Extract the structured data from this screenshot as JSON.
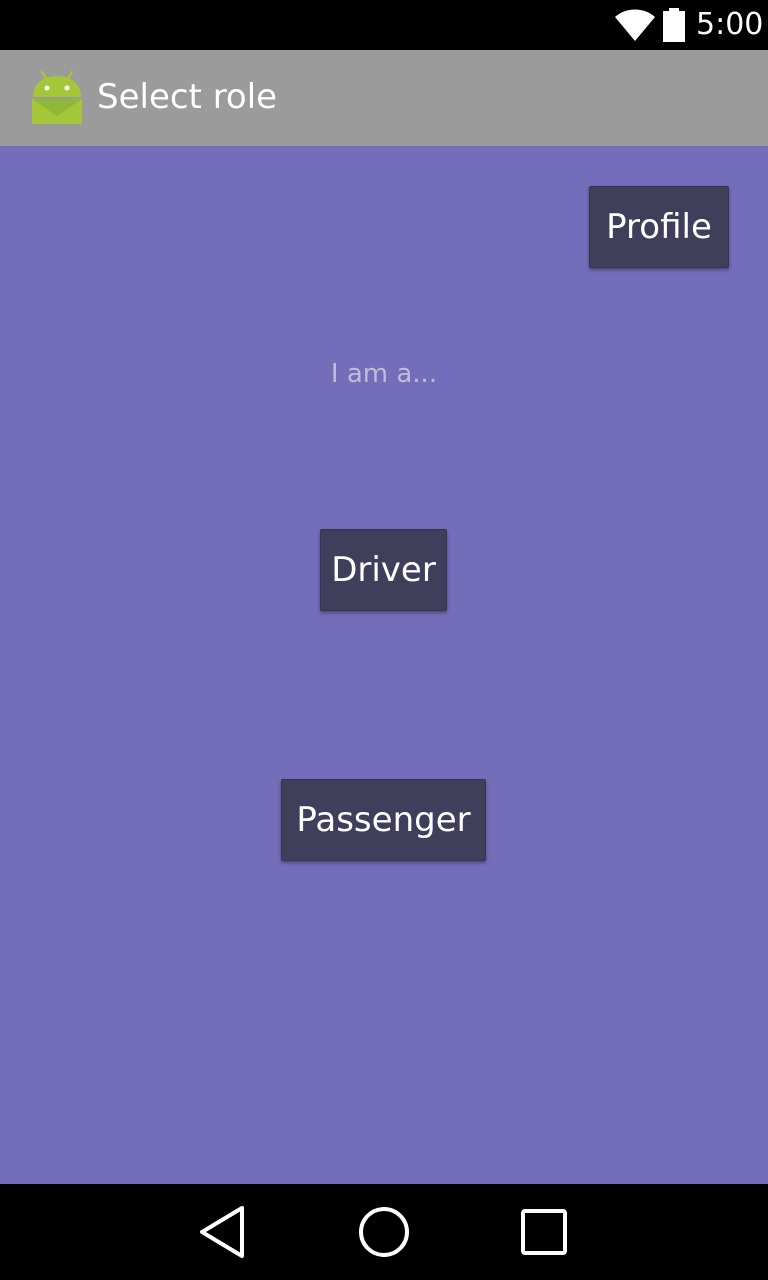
{
  "status_bar": {
    "time": "5:00",
    "icons": [
      "wifi-icon",
      "battery-icon"
    ]
  },
  "action_bar": {
    "icon": "android-icon",
    "title": "Select role",
    "background": "#9b9b9b"
  },
  "content": {
    "background": "#736dba",
    "profile_button": "Profile",
    "prompt": "I am a...",
    "driver_button": "Driver",
    "passenger_button": "Passenger",
    "button_color": "#3f3f5c"
  },
  "nav_bar": {
    "icons": [
      "back-icon",
      "home-icon",
      "recents-icon"
    ]
  }
}
